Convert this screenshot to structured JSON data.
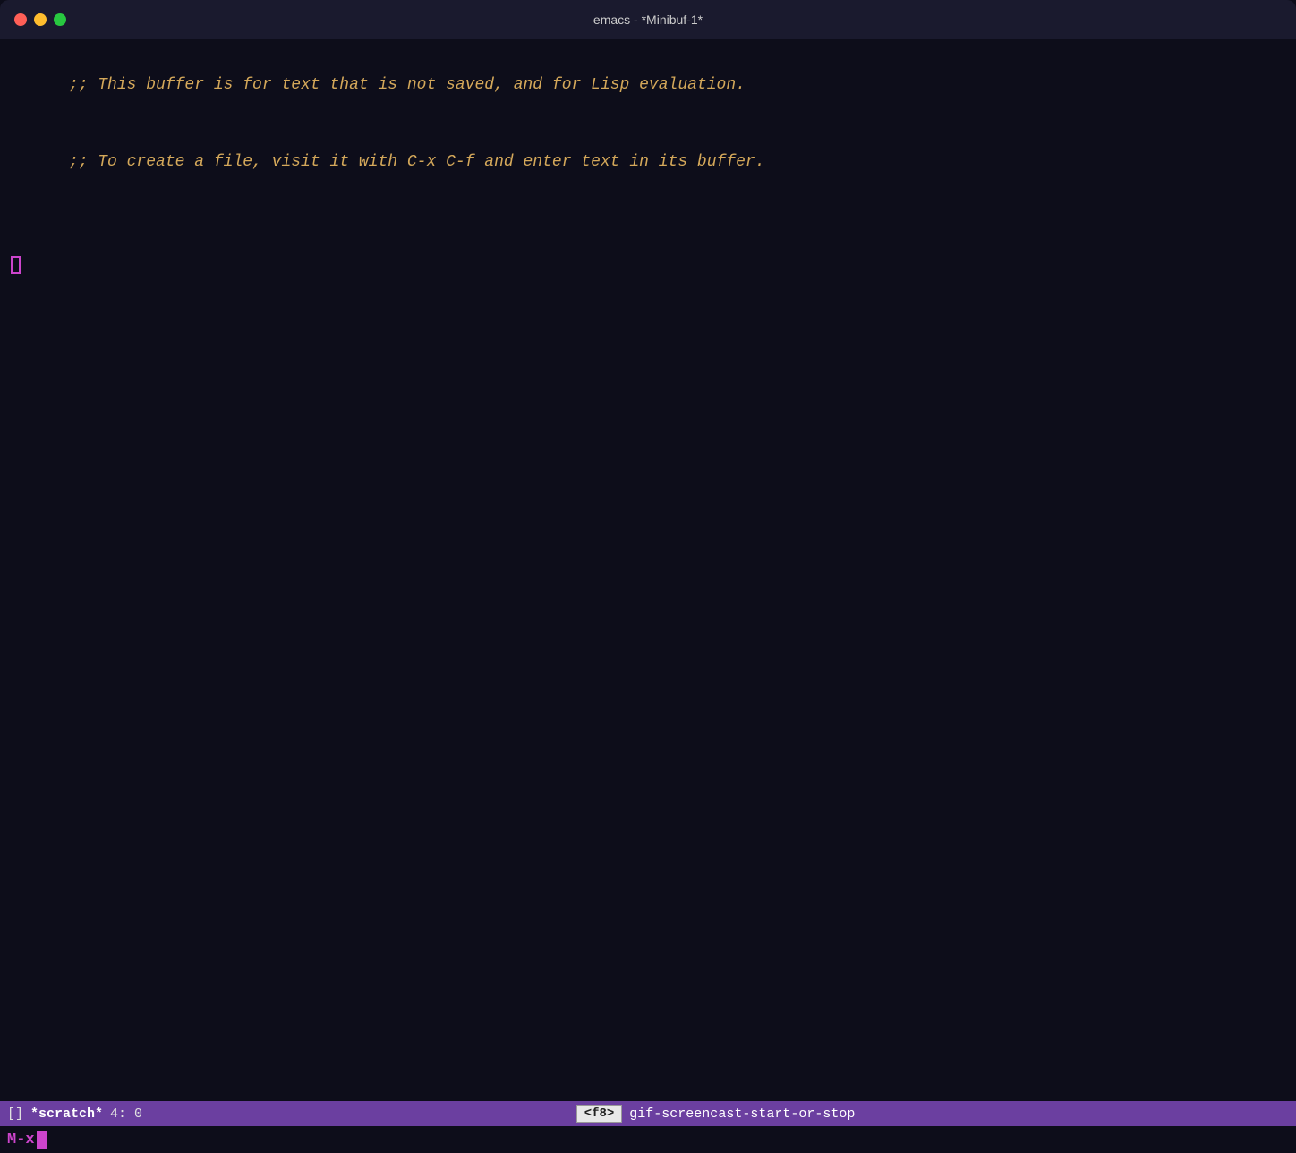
{
  "titlebar": {
    "title": "emacs - *Minibuf-1*",
    "close_label": "close",
    "minimize_label": "minimize",
    "maximize_label": "maximize"
  },
  "editor": {
    "line1": ";; This buffer is for text that is not saved, and for Lisp evaluation.",
    "line2": ";; To create a file, visit it with C-x C-f and enter text in its buffer.",
    "line3": ""
  },
  "modeline": {
    "brackets": "[]",
    "buffer_name": "*scratch*",
    "position": "4: 0",
    "f8_label": "<f8>",
    "command": "gif-screencast-start-or-stop"
  },
  "minibuf": {
    "prompt": "M-x"
  }
}
